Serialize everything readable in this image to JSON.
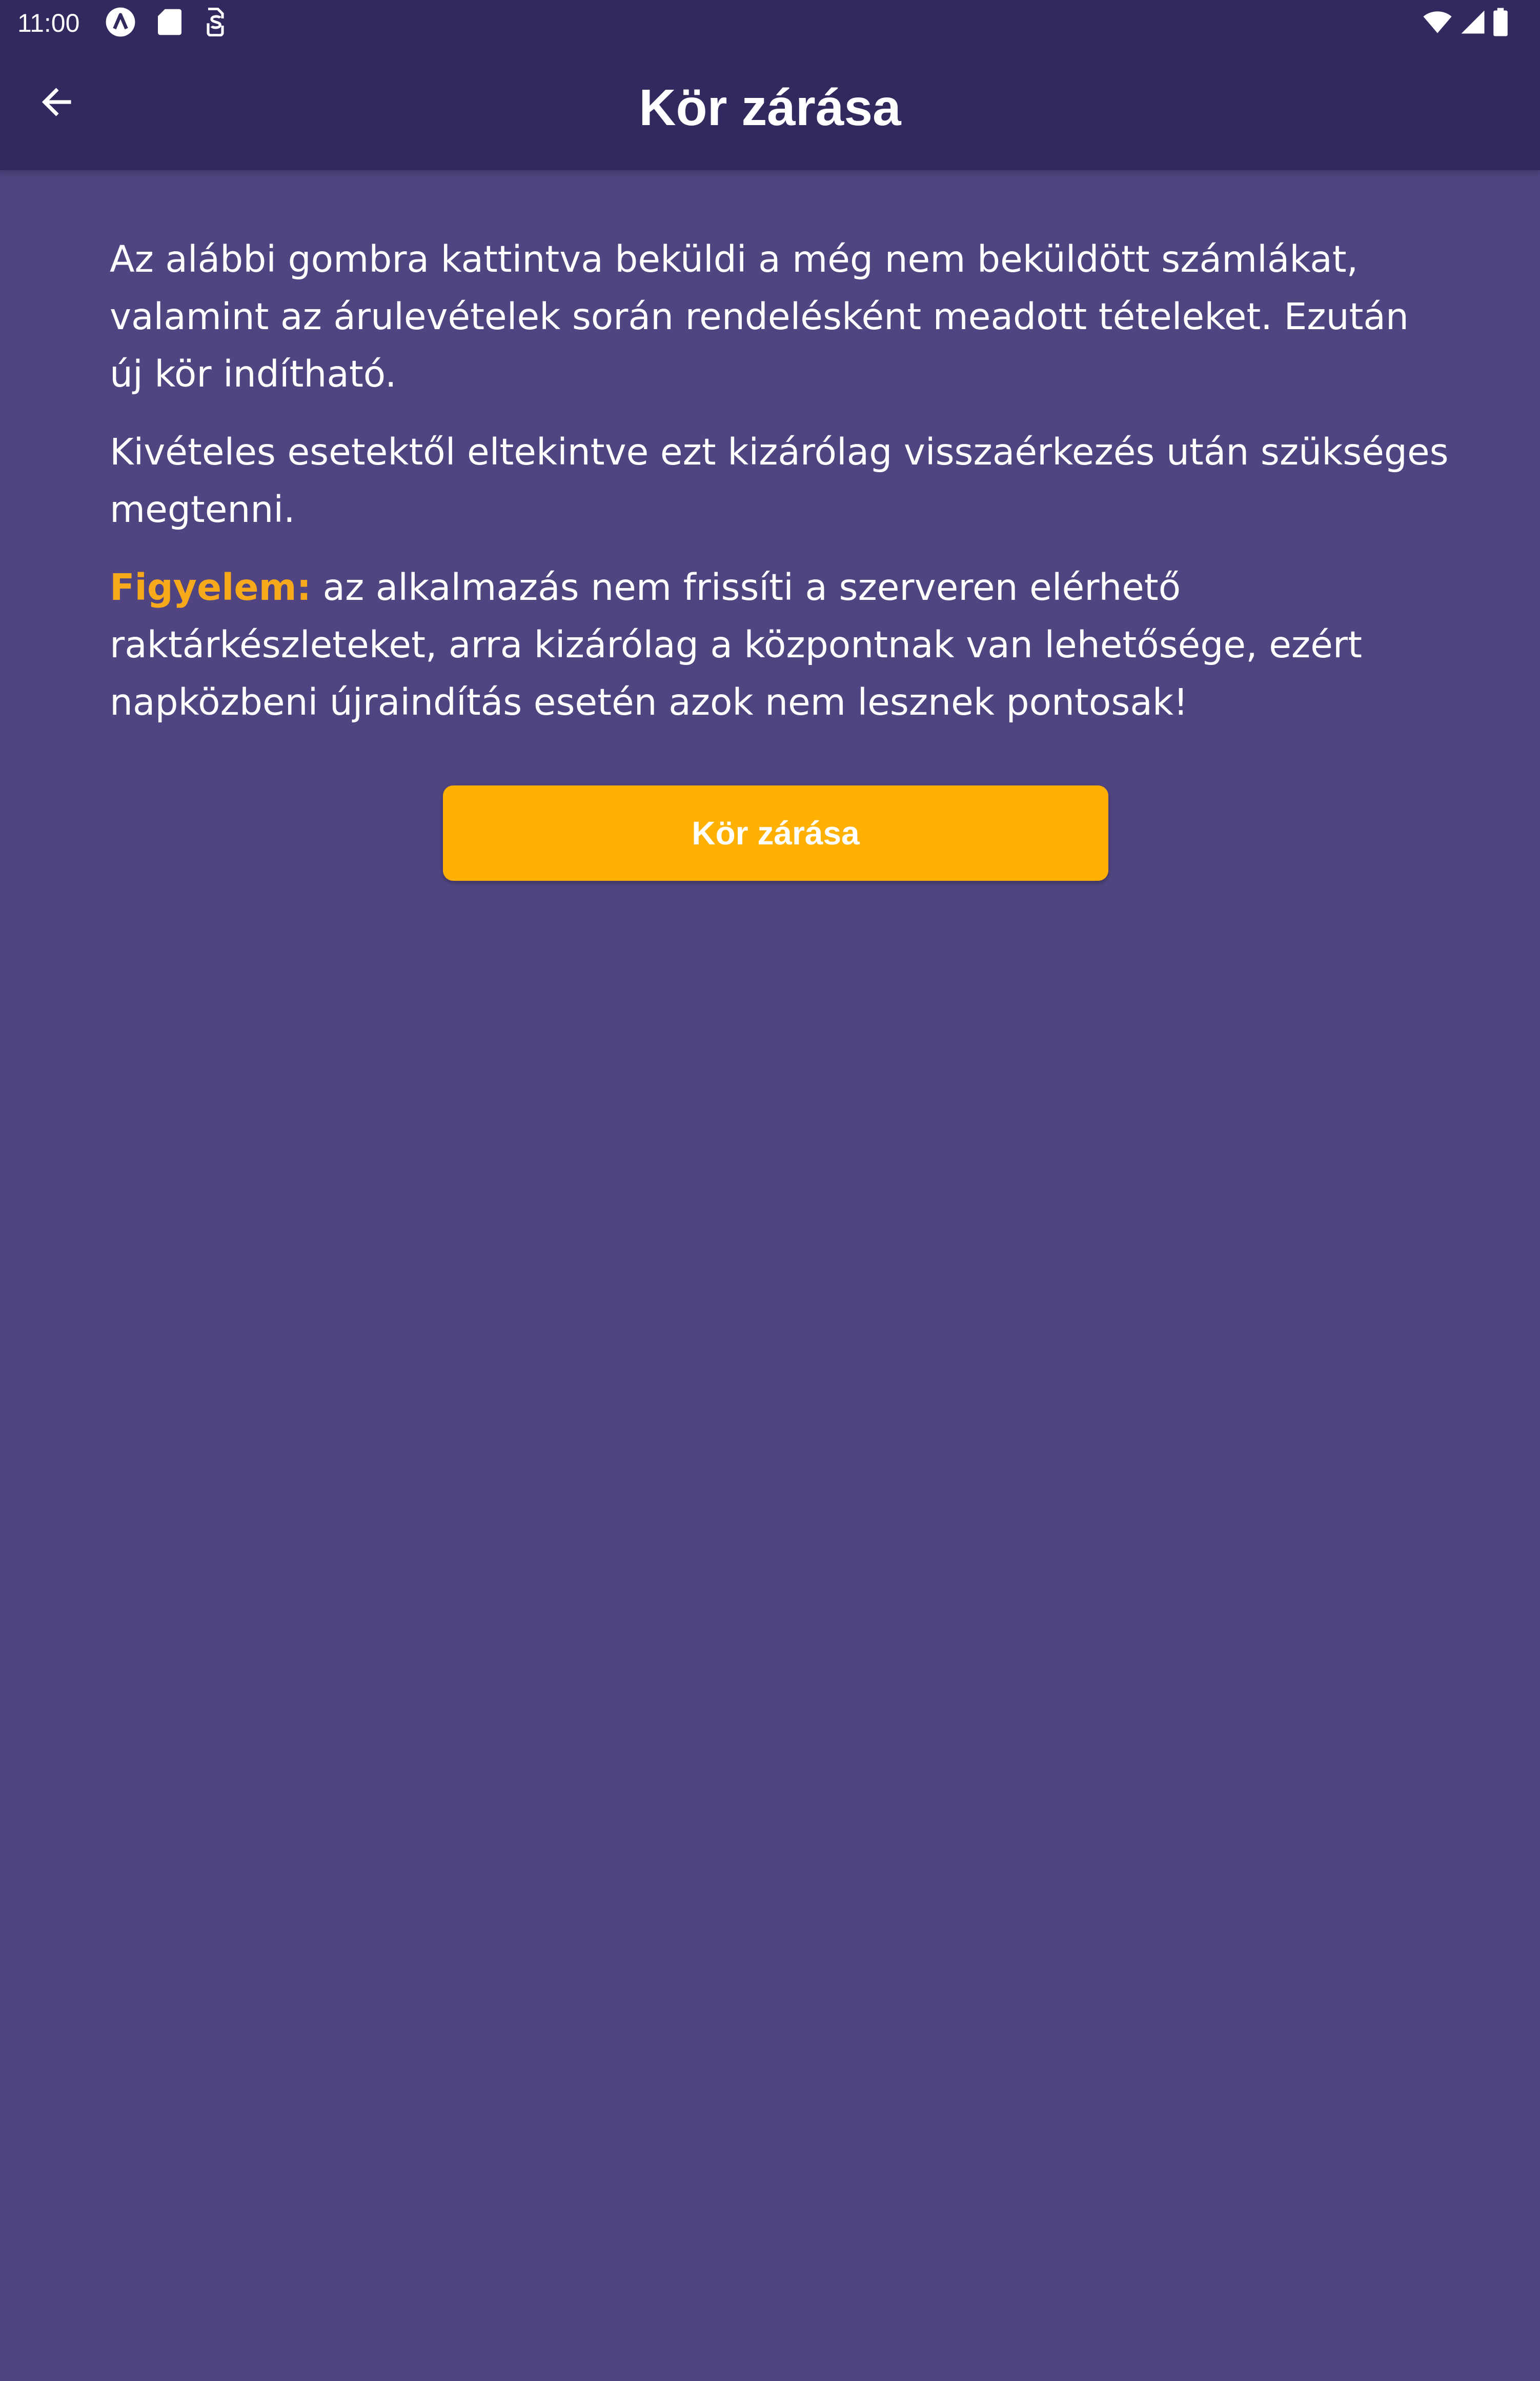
{
  "status_bar": {
    "time": "11:00",
    "icons": [
      "autofill-icon",
      "sd-card-icon",
      "sim-toolkit-icon",
      "wifi-icon",
      "cell-signal-icon",
      "battery-icon"
    ]
  },
  "app_bar": {
    "title": "Kör zárása",
    "back_icon": "arrow-back-icon"
  },
  "content": {
    "paragraph1": "Az alábbi gombra kattintva beküldi a még nem beküldött számlákat, valamint az árulevételek során rendelésként meadott tételeket. Ezután új kör indítható.",
    "paragraph2": "Kivételes esetektől eltekintve ezt kizárólag visszaérkezés után szükséges megtenni.",
    "warning_label": "Figyelem:",
    "warning_text": " az alkalmazás nem frissíti a szerveren elérhető raktárkészleteket, arra kizárólag a központnak van lehetősége, ezért napközbeni újraindítás esetén azok nem lesznek pontosak!"
  },
  "close_round_button": {
    "label": "Kör zárása"
  },
  "colors": {
    "background": "#504580",
    "app_bar": "#302a5e",
    "accent": "#ffb000",
    "warning_text": "#f7a81b"
  }
}
